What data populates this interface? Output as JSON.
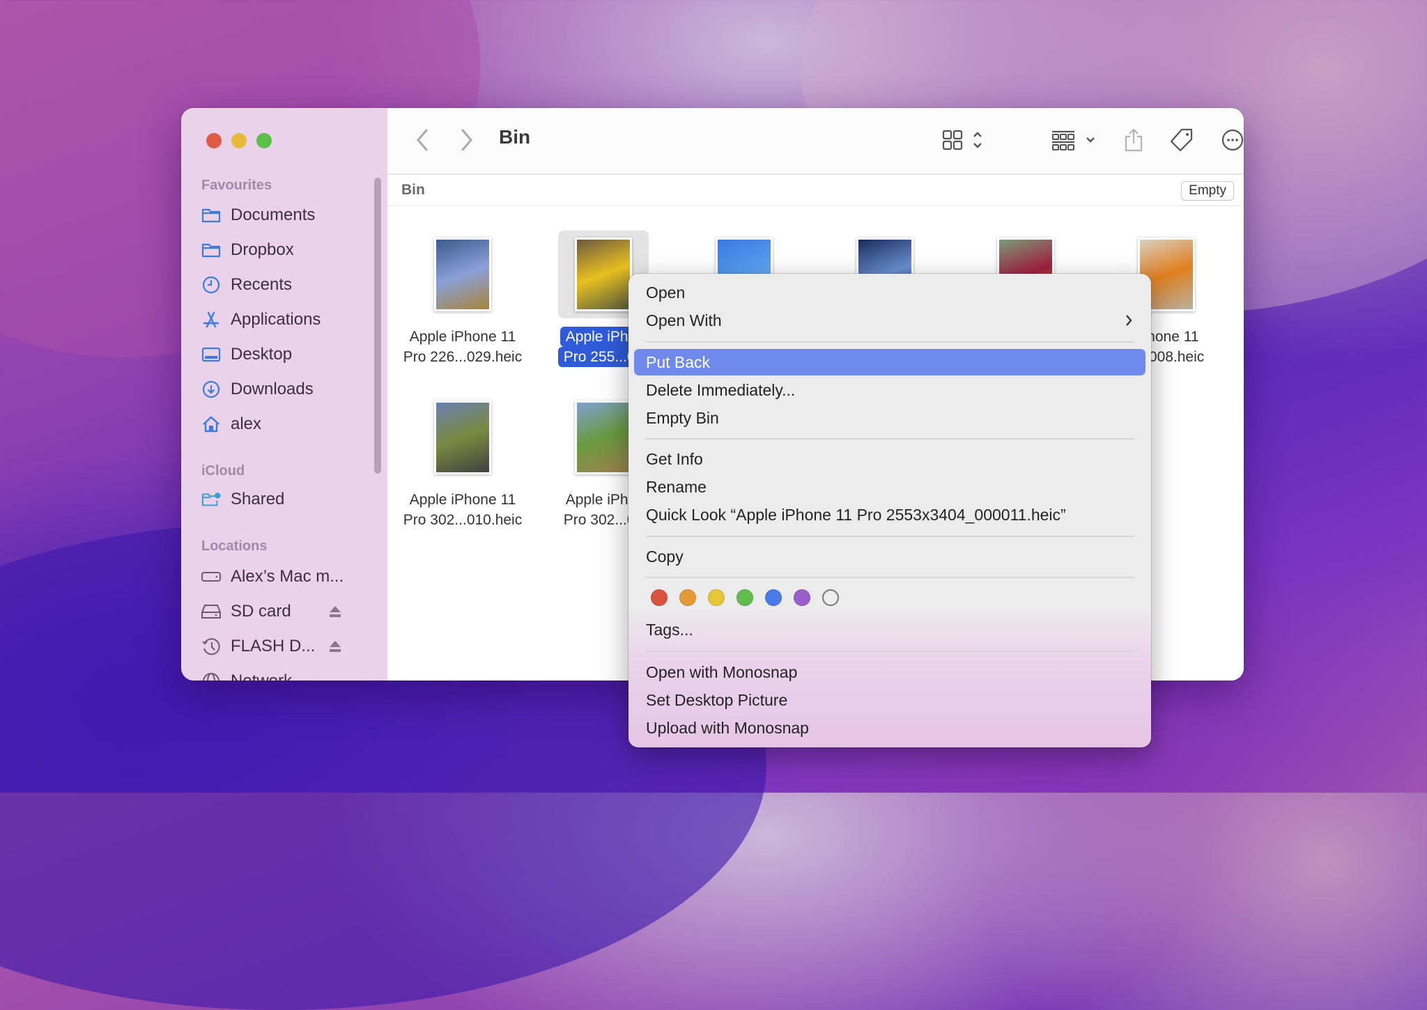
{
  "window": {
    "title": "Bin",
    "traffic_lights": [
      {
        "name": "close",
        "color": "#e05a45"
      },
      {
        "name": "minimize",
        "color": "#e8b93a"
      },
      {
        "name": "zoom",
        "color": "#5cbf4a"
      }
    ]
  },
  "sidebar": {
    "sections": [
      {
        "label": "Favourites"
      },
      {
        "label": "iCloud"
      },
      {
        "label": "Locations"
      }
    ],
    "favourites": [
      {
        "label": "Documents",
        "icon": "folder-icon"
      },
      {
        "label": "Dropbox",
        "icon": "folder-icon"
      },
      {
        "label": "Recents",
        "icon": "clock-icon"
      },
      {
        "label": "Applications",
        "icon": "applications-icon"
      },
      {
        "label": "Desktop",
        "icon": "desktop-icon"
      },
      {
        "label": "Downloads",
        "icon": "download-icon"
      },
      {
        "label": "alex",
        "icon": "home-icon"
      }
    ],
    "icloud": [
      {
        "label": "Shared",
        "icon": "shared-folder-icon"
      }
    ],
    "locations": [
      {
        "label": "Alex’s Mac m...",
        "icon": "computer-icon",
        "eject": false
      },
      {
        "label": "SD card",
        "icon": "drive-icon",
        "eject": true
      },
      {
        "label": "FLASH D...",
        "icon": "time-machine-icon",
        "eject": true
      },
      {
        "label": "Network",
        "icon": "network-icon",
        "eject": false
      }
    ]
  },
  "toolbar": {
    "title": "Bin",
    "back_icon": "chevron-left-icon",
    "forward_icon": "chevron-right-icon",
    "view_icon": "icon-view-icon",
    "group_icon": "group-by-icon",
    "share_icon": "share-icon",
    "tag_icon": "tag-icon",
    "more_icon": "ellipsis-circle-icon",
    "search_icon": "search-icon"
  },
  "pathbar": {
    "label": "Bin",
    "empty_button": "Empty"
  },
  "files": [
    {
      "line1": "Apple iPhone 11",
      "line2": "Pro 226...029.heic",
      "selected": false,
      "thumb": [
        "#3c5a8c",
        "#8aa0d8",
        "#a8843a"
      ]
    },
    {
      "line1": "Apple iPhor",
      "line2": "Pro 255...01",
      "selected": true,
      "thumb": [
        "#6b5a40",
        "#e8c020",
        "#5a6040"
      ]
    },
    {
      "line1": "",
      "line2": "",
      "selected": false,
      "thumb": [
        "#3a78e0",
        "#5aa0f0",
        "#c0d0e0"
      ]
    },
    {
      "line1": "",
      "line2": "",
      "selected": false,
      "thumb": [
        "#1a2a5a",
        "#6a90d0",
        "#203060"
      ]
    },
    {
      "line1": "",
      "line2": "",
      "selected": false,
      "thumb": [
        "#7a9a7a",
        "#a02040",
        "#e0a030"
      ]
    },
    {
      "line1": "iPhone 11",
      "line2": "2...008.heic",
      "selected": false,
      "thumb": [
        "#d8d0c0",
        "#e08020",
        "#b8b0a0"
      ]
    },
    {
      "line1": "Apple iPhone 11",
      "line2": "Pro 302...010.heic",
      "selected": false,
      "thumb": [
        "#6a80b0",
        "#7a8a40",
        "#404040"
      ]
    },
    {
      "line1": "Apple iPhor",
      "line2": "Pro 302...01",
      "selected": false,
      "thumb": [
        "#80a0d0",
        "#6a9a40",
        "#a08050"
      ]
    }
  ],
  "context_menu": {
    "items": [
      {
        "label": "Open"
      },
      {
        "label": "Open With",
        "submenu": true
      },
      {
        "label": "Put Back",
        "highlighted": true
      },
      {
        "label": "Delete Immediately..."
      },
      {
        "label": "Empty Bin"
      },
      {
        "label": "Get Info"
      },
      {
        "label": "Rename"
      },
      {
        "label": "Quick Look “Apple iPhone 11 Pro 2553x3404_000011.heic”"
      },
      {
        "label": "Copy"
      },
      {
        "label": "Tags..."
      },
      {
        "label": "Open with Monosnap"
      },
      {
        "label": "Set Desktop Picture"
      },
      {
        "label": "Upload with Monosnap"
      }
    ],
    "tag_colors": [
      {
        "name": "red",
        "color": "#d9533f"
      },
      {
        "name": "orange",
        "color": "#e39a35"
      },
      {
        "name": "yellow",
        "color": "#e6c634"
      },
      {
        "name": "green",
        "color": "#62bb4e"
      },
      {
        "name": "blue",
        "color": "#4a7bea"
      },
      {
        "name": "purple",
        "color": "#9a5fcc"
      },
      {
        "name": "none",
        "color": "#ffffff"
      }
    ],
    "highlight_color": "#7089ec"
  }
}
